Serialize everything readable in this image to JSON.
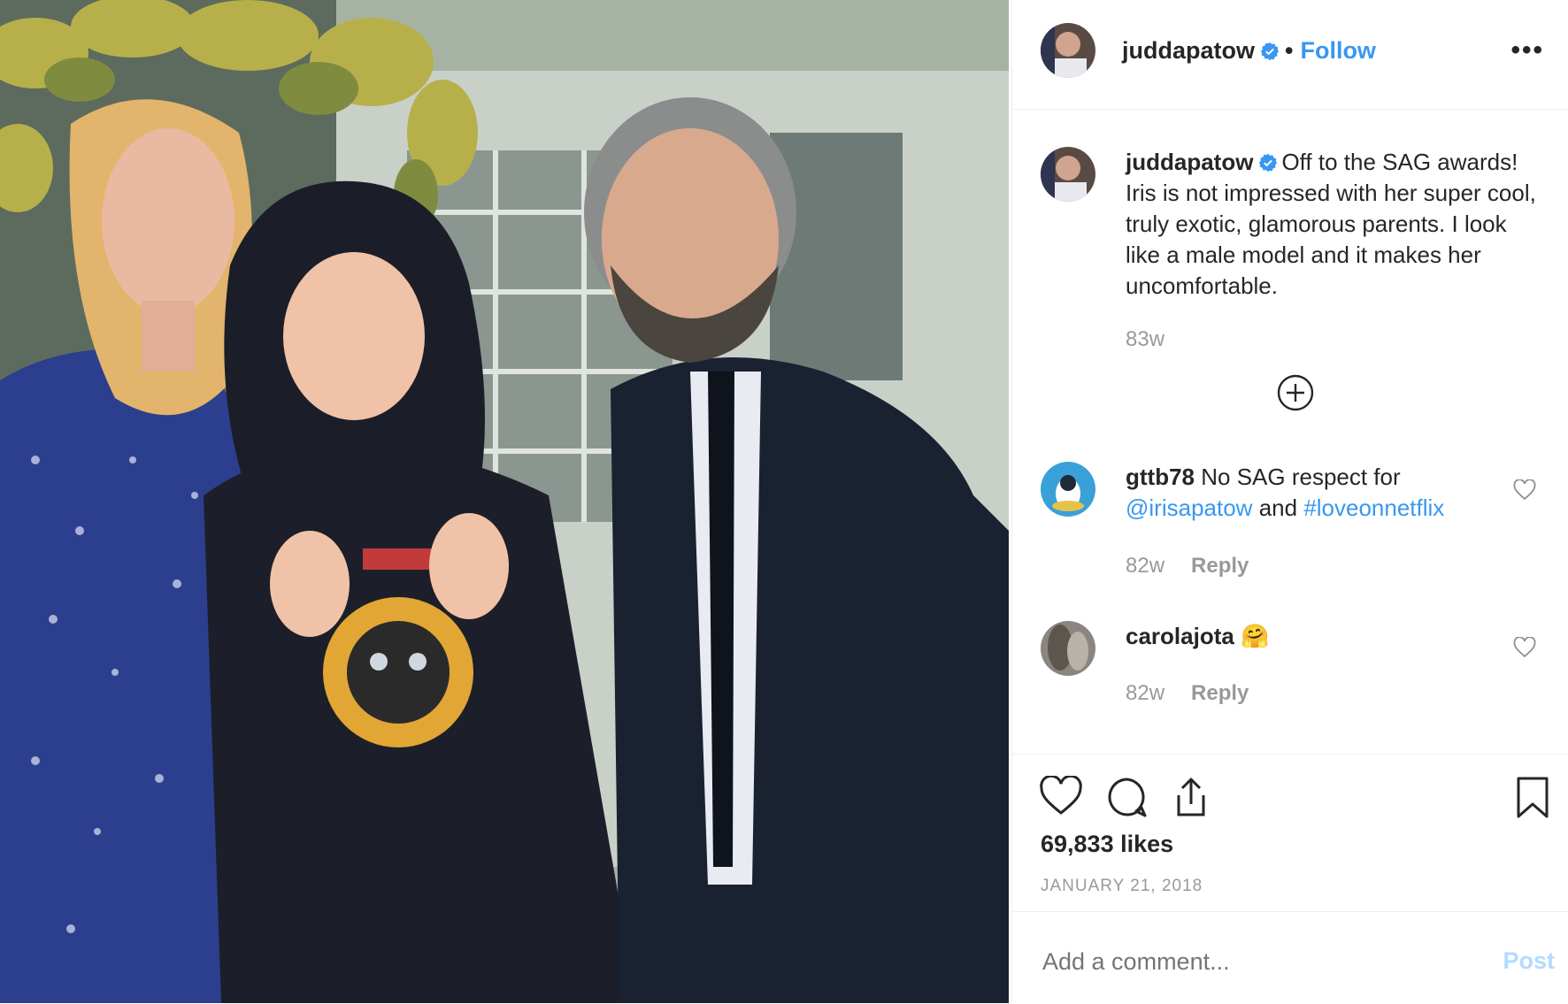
{
  "post": {
    "username": "juddapatow",
    "separator": "•",
    "follow_label": "Follow",
    "more_label": "•••",
    "caption": {
      "username": "juddapatow",
      "text": "Off to the SAG awards! Iris is not impressed with her super cool, truly exotic, glamorous parents. I look like a male model and it makes her uncomfortable.",
      "age": "83w"
    },
    "load_more_icon": "plus-circle-icon",
    "comments": [
      {
        "username": "gttb78",
        "text_before": "No SAG respect for",
        "mention": "@irisapatow",
        "text_middle": "and",
        "hashtag": "#loveonnetflix",
        "age": "82w",
        "reply_label": "Reply"
      },
      {
        "username": "carolajota",
        "emoji": "🤗",
        "age": "82w",
        "reply_label": "Reply"
      }
    ],
    "likes": "69,833 likes",
    "date": "JANUARY 21, 2018",
    "comment_placeholder": "Add a comment...",
    "post_label": "Post"
  },
  "colors": {
    "link": "#3897f0",
    "muted": "#999999",
    "text": "#262626",
    "post_disabled": "#b3dbff"
  }
}
